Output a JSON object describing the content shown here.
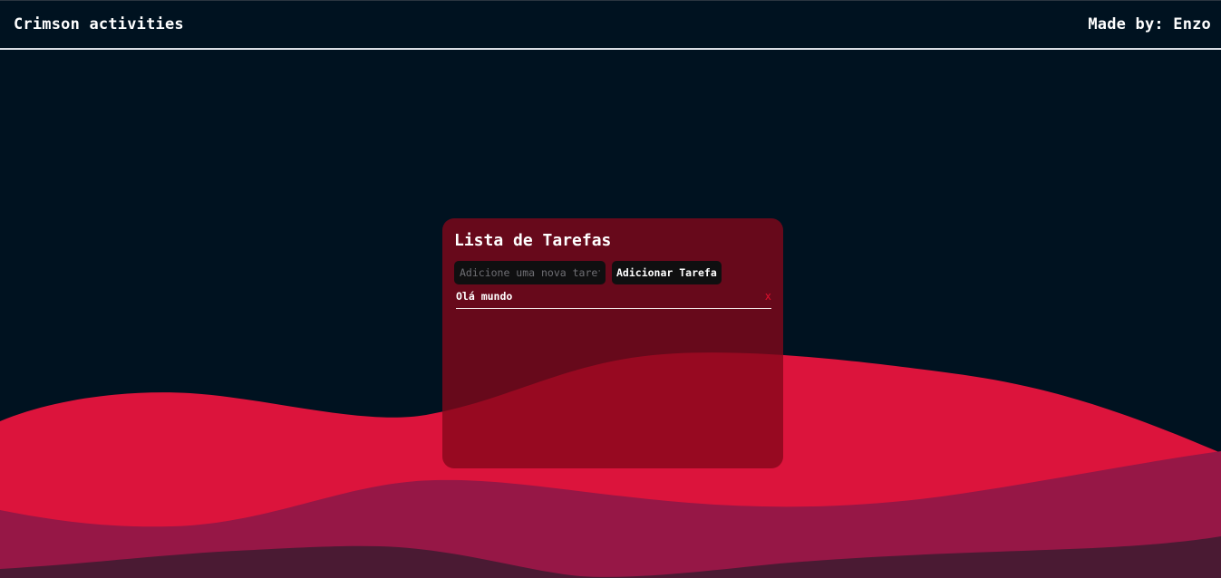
{
  "header": {
    "title": "Crimson activities",
    "credit": "Made by: Enzo"
  },
  "todo": {
    "title": "Lista de Tarefas",
    "input_placeholder": "Adicione uma nova tarefa",
    "input_value": "",
    "add_button_label": "Adicionar Tarefa",
    "tasks": [
      {
        "text": "Olá mundo",
        "delete_label": "x"
      }
    ]
  },
  "colors": {
    "background": "#001220",
    "wave_front": "#dc143c",
    "wave_middle": "#961746",
    "wave_back": "#4a1a33",
    "card": "#84061a",
    "delete": "#e0102e"
  }
}
